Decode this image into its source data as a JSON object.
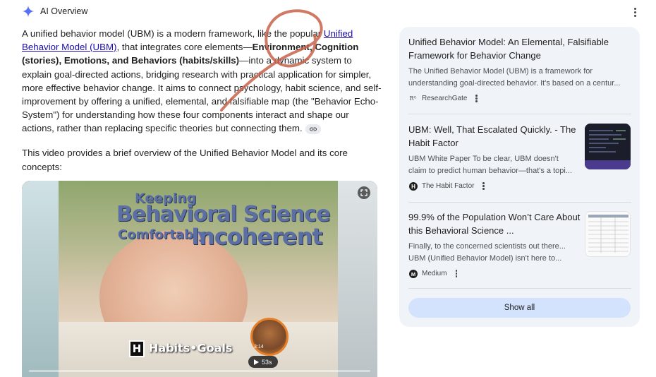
{
  "header": {
    "title": "AI Overview"
  },
  "main": {
    "paragraph1": {
      "intro": "A unified behavior model (UBM) is a modern framework, like the popular ",
      "link_text": "Unified Behavior Model (UBM)",
      "mid": ", that integrates core elements—",
      "bold_text": "Environment, Cognition (stories), Emotions, and Behaviors (habits/skills)",
      "rest": "—into a dynamic system to explain goal-directed actions, bridging research with practical application for simpler, more effective behavior change. It aims to connect psychology, habit science, and self-improvement by offering a unified, elemental, and falsifiable map (the \"Behavior Echo-System\") for understanding how these four components interact and shape our actions, rather than replacing specific theories but connecting them."
    },
    "paragraph2": "This video provides a brief overview of the Unified Behavior Model and its core concepts:"
  },
  "video": {
    "overlay_line1": "Keeping",
    "overlay_line2": "Behavioral Science",
    "overlay_line3": "Comfortably",
    "overlay_line4": "Incoherent",
    "logo_text": "Habits•Goals",
    "logo_letter": "H",
    "timestamp": "3:14",
    "duration_label": "53s"
  },
  "sources": [
    {
      "title": "Unified Behavior Model: An Elemental, Falsifiable Framework for Behavior Change",
      "snippet": "The Unified Behavior Model (UBM) is a framework for understanding goal-directed behavior. It's based on a centur...",
      "site": "ResearchGate",
      "favicon_text": "Rᴳ"
    },
    {
      "title": "UBM: Well, That Escalated Quickly. - The Habit Factor",
      "snippet": "UBM White Paper To be clear, UBM doesn't claim to predict human behavior—that's a topi...",
      "site": "The Habit Factor",
      "favicon_text": "H"
    },
    {
      "title": "99.9% of the Population Won’t Care About this Behavioral Science ...",
      "snippet": "Finally, to the concerned scientists out there... UBM (Unified Behavior Model) isn't here to...",
      "site": "Medium",
      "favicon_text": "M"
    }
  ],
  "show_all_label": "Show all",
  "colors": {
    "link": "#1a0dab",
    "sidebar_bg": "#f0f4f9",
    "show_all_bg": "#d3e3fd",
    "annotation": "#c8624a"
  }
}
